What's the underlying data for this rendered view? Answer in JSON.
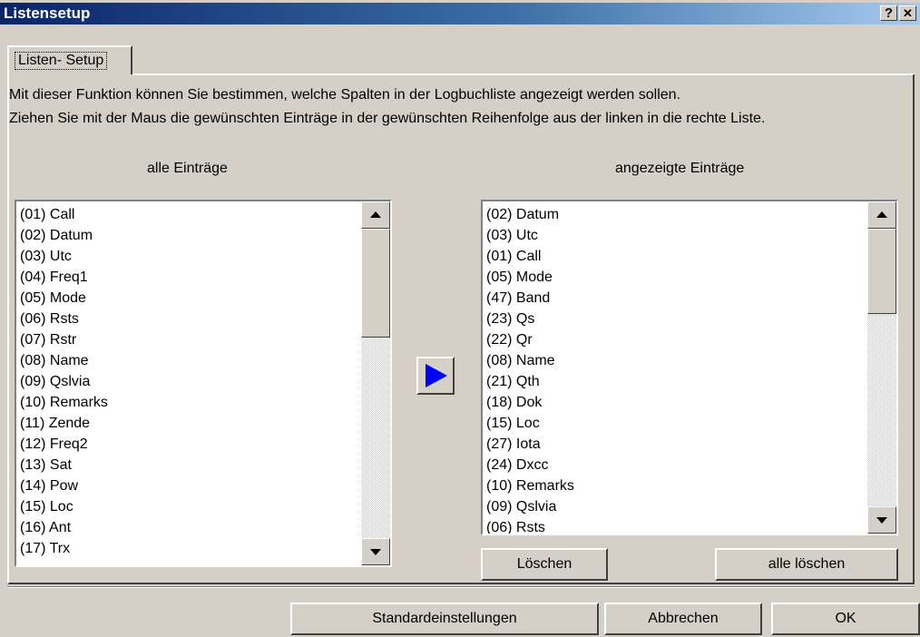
{
  "window": {
    "title": "Listensetup",
    "help_button": "?",
    "close_button": "✕"
  },
  "tab": {
    "label": "Listen- Setup"
  },
  "description": {
    "line1": "Mit dieser Funktion können Sie bestimmen, welche Spalten in der Logbuchliste angezeigt werden sollen.",
    "line2": "Ziehen Sie mit der Maus die gewünschten Einträge in der gewünschten Reihenfolge aus der linken in die rechte Liste."
  },
  "left_list": {
    "header": "alle Einträge",
    "items": [
      "(01) Call",
      "(02) Datum",
      "(03) Utc",
      "(04) Freq1",
      "(05) Mode",
      "(06) Rsts",
      "(07) Rstr",
      "(08) Name",
      "(09) Qslvia",
      "(10) Remarks",
      "(11) Zende",
      "(12) Freq2",
      "(13) Sat",
      "(14) Pow",
      "(15) Loc",
      "(16) Ant",
      "(17) Trx"
    ]
  },
  "right_list": {
    "header": "angezeigte Einträge",
    "items": [
      "(02) Datum",
      "(03) Utc",
      "(01) Call",
      "(05) Mode",
      "(47) Band",
      "(23) Qs",
      "(22) Qr",
      "(08) Name",
      "(21) Qth",
      "(18) Dok",
      "(15) Loc",
      "(27) Iota",
      "(24) Dxcc",
      "(10) Remarks",
      "(09) Qslvia",
      "(06) Rsts"
    ]
  },
  "buttons": {
    "loeschen": "Löschen",
    "alle_loeschen": "alle löschen",
    "standard": "Standardeinstellungen",
    "abbrechen": "Abbrechen",
    "ok": "OK"
  },
  "icons": {
    "move_right": "play-right-arrow-icon"
  },
  "colors": {
    "titlebar_start": "#0a246a",
    "titlebar_end": "#a6caf0",
    "arrow": "#0000ff",
    "face": "#d4d0c8"
  }
}
